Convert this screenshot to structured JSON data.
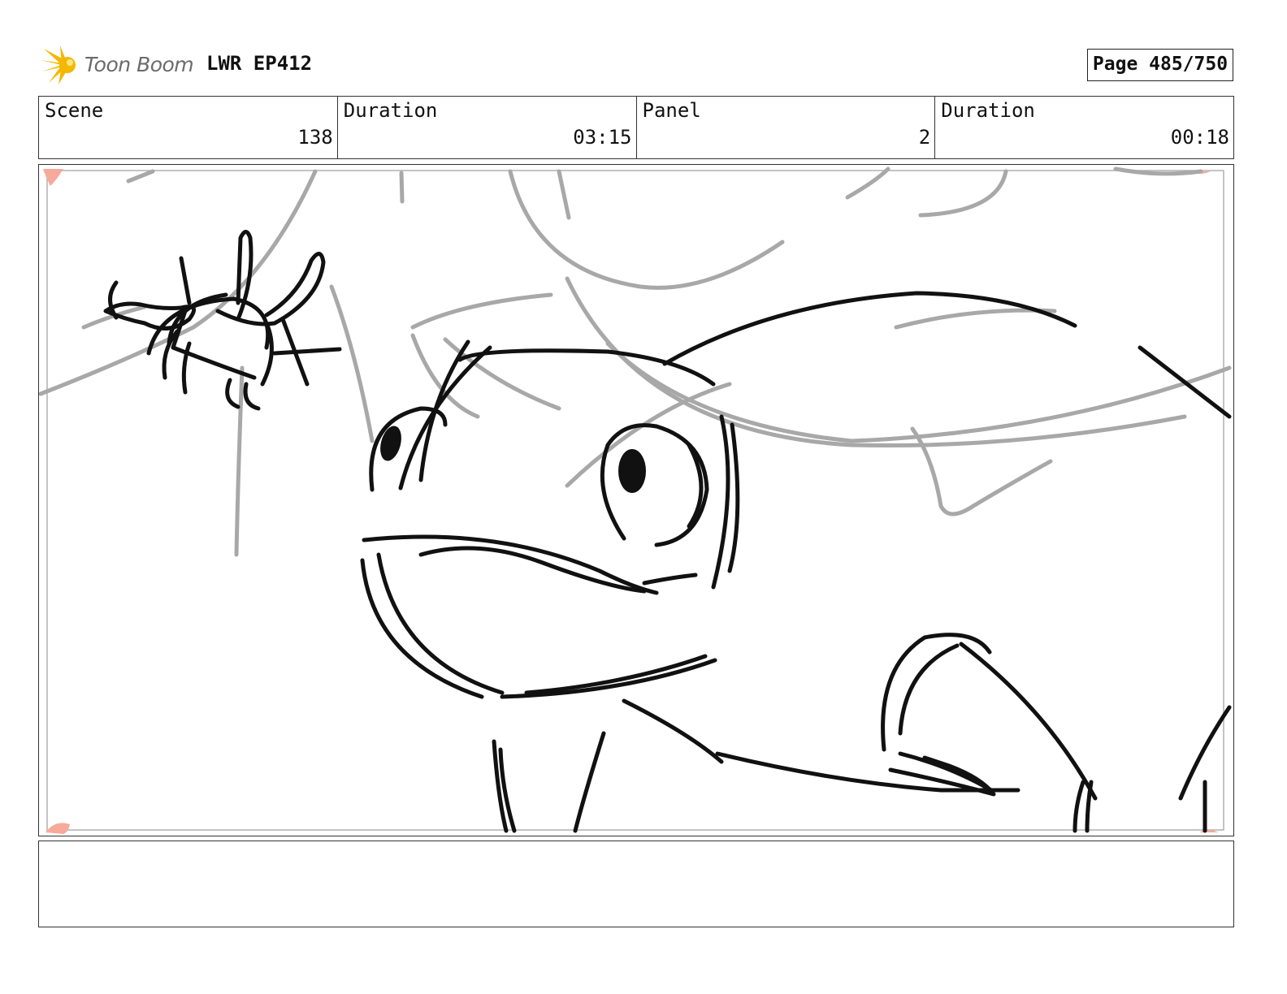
{
  "header": {
    "logo_text": "Toon Boom",
    "logo_icon": "toon-boom-star-burst-icon",
    "project_title": "LWR EP412",
    "page_label": "Page 485/750"
  },
  "info": {
    "scene_label": "Scene",
    "scene_value": "138",
    "scene_duration_label": "Duration",
    "scene_duration_value": "03:15",
    "panel_label": "Panel",
    "panel_value": "2",
    "panel_duration_label": "Duration",
    "panel_duration_value": "00:18"
  },
  "panel": {
    "sketch": "rough storyboard drawing of a creature looking at a bug"
  },
  "caption": {
    "text": ""
  },
  "colors": {
    "logo_yellow": "#f5b800",
    "rough_line": "#a8a8a8",
    "ink_line": "#111111",
    "corner_marker": "#f7a99a"
  }
}
